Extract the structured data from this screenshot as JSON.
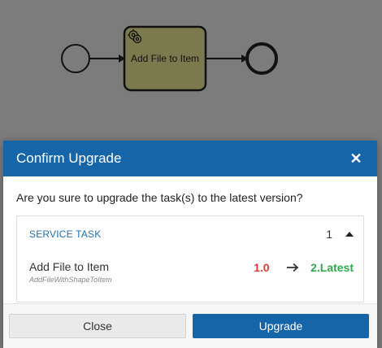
{
  "diagram": {
    "task_label": "Add File to Item",
    "task_icon": "gear-icon",
    "colors": {
      "task_fill": "#7b7a4e",
      "stroke": "#111111",
      "overlay": "#7c7c7c"
    }
  },
  "modal": {
    "title": "Confirm Upgrade",
    "close_icon": "close-icon",
    "question": "Are you sure to upgrade the task(s) to the latest version?",
    "panel": {
      "type_label": "SERVICE TASK",
      "count": "1",
      "tasks": [
        {
          "name": "Add File to Item",
          "id": "AddFileWithShapeToItem",
          "old_version": "1.0",
          "new_version": "2.Latest"
        }
      ]
    },
    "buttons": {
      "close": "Close",
      "upgrade": "Upgrade"
    },
    "colors": {
      "header": "#1565a8",
      "old_version": "#e53935",
      "new_version": "#2eaa4f",
      "accent_text": "#1f6fb0"
    }
  }
}
